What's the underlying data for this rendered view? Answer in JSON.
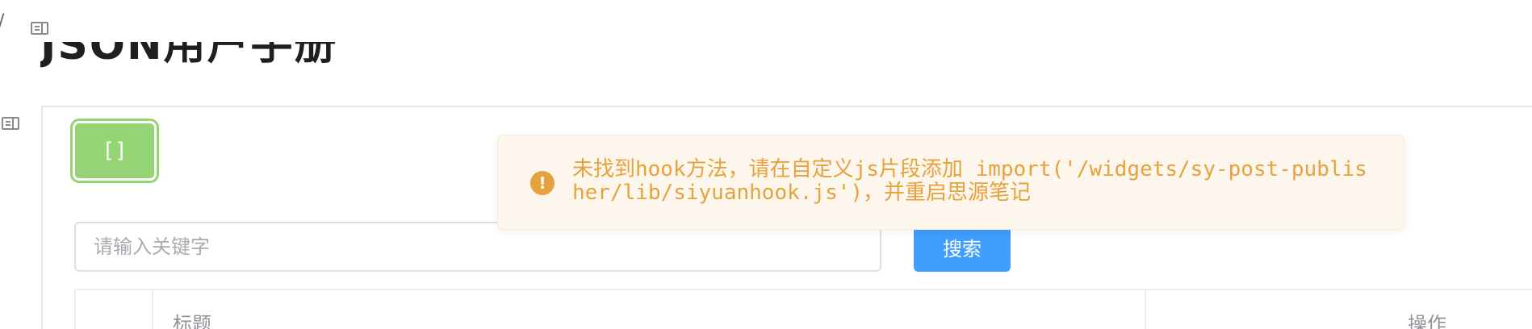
{
  "breadcrumb": {
    "separator": "/"
  },
  "icons": {
    "top_doc": "doc-icon",
    "side_doc": "doc-icon",
    "alert": "warning-circle-icon"
  },
  "document": {
    "title": "JSON用户手册"
  },
  "widget": {
    "json_button_label": "[]",
    "search": {
      "placeholder": "请输入关键字",
      "value": "",
      "button_label": "搜索"
    },
    "table": {
      "columns": [
        "",
        "标题",
        "操作"
      ]
    }
  },
  "alert": {
    "type": "warning",
    "message": "未找到hook方法，请在自定义js片段添加 import('/widgets/sy-post-publisher/lib/siyuanhook.js')，并重启思源笔记"
  },
  "colors": {
    "success": "#95d475",
    "primary": "#409eff",
    "warning": "#e6a23c",
    "warning_bg": "#fdf6ec"
  }
}
